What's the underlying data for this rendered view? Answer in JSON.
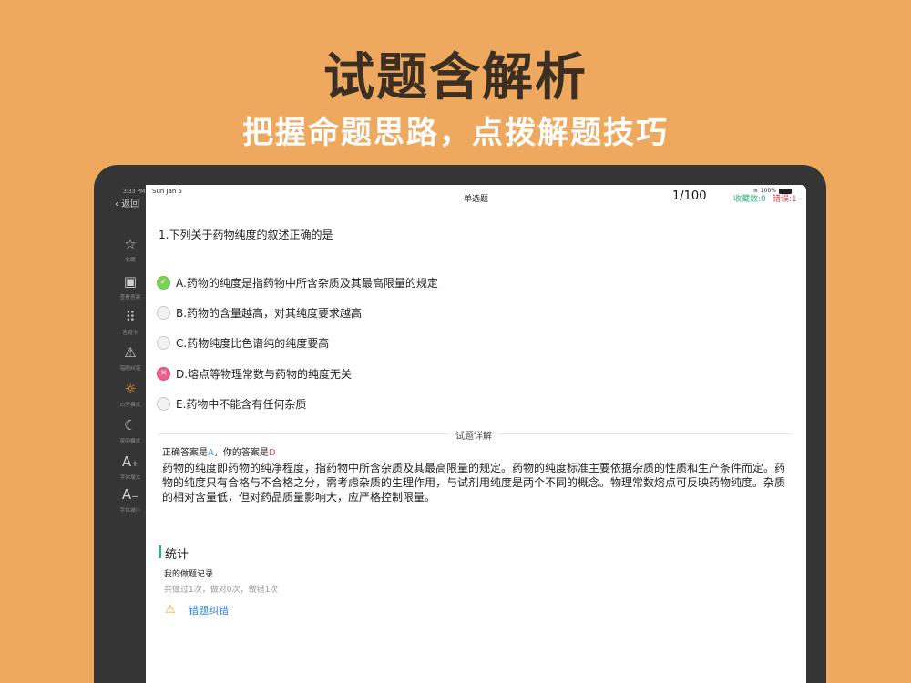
{
  "hero": {
    "title": "试题含解析",
    "subtitle": "把握命题思路，点拨解题技巧"
  },
  "sidebar": {
    "status_time": "3:33 PM",
    "back_label": "返回",
    "items": [
      {
        "icon": "star-icon",
        "glyph": "☆",
        "label": "收藏"
      },
      {
        "icon": "answer-icon",
        "glyph": "▣",
        "label": "查看答案"
      },
      {
        "icon": "grid-icon",
        "glyph": "⠿",
        "label": "答题卡"
      },
      {
        "icon": "warning-icon",
        "glyph": "⚠",
        "label": "错题纠错"
      },
      {
        "icon": "sun-icon",
        "glyph": "☼",
        "label": "白天模式"
      },
      {
        "icon": "moon-icon",
        "glyph": "☾",
        "label": "夜间模式"
      },
      {
        "icon": "font-increase-icon",
        "glyph": "A₊",
        "label": "字体增大"
      },
      {
        "icon": "font-decrease-icon",
        "glyph": "A₋",
        "label": "字体减小"
      }
    ]
  },
  "status_bar": {
    "date": "Sun Jan 5",
    "battery": "100%"
  },
  "nav": {
    "title": "单选题",
    "count": "1/100",
    "favorites": "收藏数:0",
    "errors": "错误:1"
  },
  "question": {
    "text": "1.下列关于药物纯度的叙述正确的是",
    "options": [
      {
        "text": "A.药物的纯度是指药物中所含杂质及其最高限量的规定",
        "state": "correct"
      },
      {
        "text": "B.药物的含量越高，对其纯度要求越高",
        "state": "none"
      },
      {
        "text": "C.药物纯度比色谱纯的纯度要高",
        "state": "none"
      },
      {
        "text": "D.熔点等物理常数与药物的纯度无关",
        "state": "wrong"
      },
      {
        "text": "E.药物中不能含有任何杂质",
        "state": "none"
      }
    ]
  },
  "detail": {
    "divider_label": "试题详解",
    "answer_prefix": "正确答案是",
    "correct_answer": "A",
    "answer_middle": "，你的答案是",
    "my_answer": "D",
    "explanation": "药物的纯度即药物的纯净程度，指药物中所含杂质及其最高限量的规定。药物的纯度标准主要依据杂质的性质和生产条件而定。药物的纯度只有合格与不合格之分，需考虑杂质的生理作用，与试剂用纯度是两个不同的概念。物理常数熔点可反映药物纯度。杂质的相对含量低，但对药品质量影响大，应严格控制限量。"
  },
  "stats": {
    "title": "统计",
    "record_title": "我的做题记录",
    "record_detail": "共做过1次，做对0次，做错1次",
    "report_label": "错题纠错"
  },
  "colors": {
    "background": "#efa95e",
    "accent_green": "#33b07a",
    "error_red": "#e24a4a",
    "link_blue": "#2d82d6"
  }
}
